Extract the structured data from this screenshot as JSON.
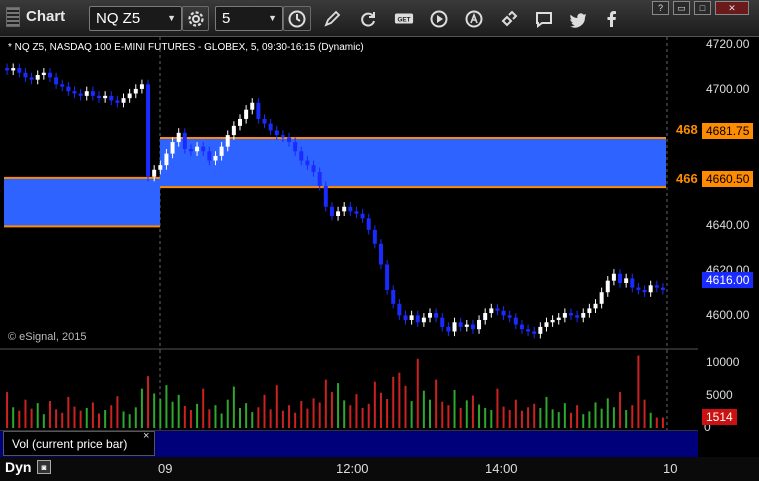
{
  "app": {
    "title": "Chart"
  },
  "toolbar": {
    "symbol": "NQ Z5",
    "interval": "5",
    "buttons": [
      "settings-icon",
      "clock-icon",
      "pencil-icon",
      "refresh-icon",
      "get-icon",
      "play-icon",
      "alert-icon",
      "link-icon",
      "chat-icon",
      "twitter-icon",
      "facebook-icon"
    ],
    "get_label": "GET"
  },
  "window": {
    "help": "?",
    "minimize": "▭",
    "maximize": "□",
    "close": "✕"
  },
  "chart": {
    "description": "* NQ Z5, NASDAQ 100 E-MINI FUTURES - GLOBEX, 5, 09:30-16:15 (Dynamic)",
    "copyright": "© eSignal, 2015",
    "price_labels": [
      "4720.00",
      "4700.00",
      "4680.00",
      "4660.00",
      "4640.00",
      "4620.00",
      "4600.00"
    ],
    "level_high": "4681.75",
    "level_low": "4660.50",
    "level_high_short": "468",
    "level_low_short": "466",
    "last_price": "4616.00",
    "time_labels": [
      "09",
      "12:00",
      "14:00",
      "10"
    ],
    "colors": {
      "up": "#ffffff",
      "down": "#1a2bff",
      "zone": "#2e63ff",
      "level": "#ff8c00",
      "vol_up": "#2ea82e",
      "vol_down": "#cc2222"
    }
  },
  "volume": {
    "title": "Vol (current price bar)",
    "close": "×",
    "labels": [
      "10000",
      "5000",
      "0"
    ],
    "last": "1514"
  },
  "footer": {
    "mode": "Dyn"
  },
  "chart_data": {
    "type": "candlestick",
    "symbol": "NQ Z5",
    "y_range": [
      4590,
      4722
    ],
    "x_ticks": [
      "09",
      "12:00",
      "14:00",
      "10"
    ],
    "reference_levels": [
      4681.75,
      4660.5
    ],
    "last_price": 4616.0,
    "close_series": [
      4711,
      4712,
      4710,
      4708,
      4707,
      4709,
      4710,
      4708,
      4705,
      4704,
      4702,
      4701,
      4700,
      4702,
      4700,
      4699,
      4700,
      4698,
      4697,
      4699,
      4701,
      4703,
      4705,
      4665,
      4668,
      4670,
      4675,
      4680,
      4684,
      4677,
      4676,
      4678,
      4676,
      4672,
      4674,
      4678,
      4683,
      4687,
      4690,
      4694,
      4697,
      4690,
      4688,
      4685,
      4683,
      4682,
      4680,
      4676,
      4672,
      4670,
      4667,
      4661,
      4652,
      4648,
      4650,
      4652,
      4650,
      4649,
      4647,
      4642,
      4636,
      4627,
      4616,
      4610,
      4605,
      4603,
      4605,
      4602,
      4604,
      4606,
      4604,
      4600,
      4598,
      4602,
      4600,
      4601,
      4599,
      4603,
      4606,
      4608,
      4607,
      4605,
      4604,
      4601,
      4599,
      4598,
      4597,
      4600,
      4602,
      4603,
      4604,
      4606,
      4605,
      4604,
      4606,
      4608,
      4610,
      4615,
      4620,
      4623,
      4619,
      4621,
      4617,
      4616,
      4615,
      4618,
      4617,
      4616
    ],
    "volume_series": [
      5200,
      3000,
      2500,
      4100,
      2800,
      3600,
      2000,
      3900,
      2700,
      2200,
      4500,
      3100,
      2500,
      2900,
      3700,
      2100,
      2600,
      3300,
      4600,
      2400,
      2000,
      3000,
      5700,
      7500,
      5000,
      4200,
      6200,
      3800,
      4800,
      3200,
      2600,
      3500,
      5700,
      2700,
      3300,
      2100,
      4100,
      6000,
      2900,
      3600,
      2300,
      3000,
      4800,
      2700,
      6200,
      2500,
      3300,
      2200,
      3900,
      2800,
      4300,
      3700,
      7000,
      5200,
      6500,
      4000,
      3300,
      4900,
      2900,
      3500,
      6700,
      5100,
      4200,
      7400,
      8000,
      6100,
      3900,
      10000,
      5400,
      4100,
      7000,
      3800,
      3300,
      5500,
      2900,
      4000,
      4700,
      3400,
      2900,
      2600,
      5700,
      3100,
      2600,
      4100,
      2500,
      3000,
      3500,
      2900,
      4500,
      2700,
      2300,
      3600,
      2200,
      3300,
      2000,
      2400,
      3700,
      2800,
      4300,
      3000,
      5200,
      2600,
      3300,
      10500,
      4100,
      2200,
      1514,
      1514
    ]
  }
}
